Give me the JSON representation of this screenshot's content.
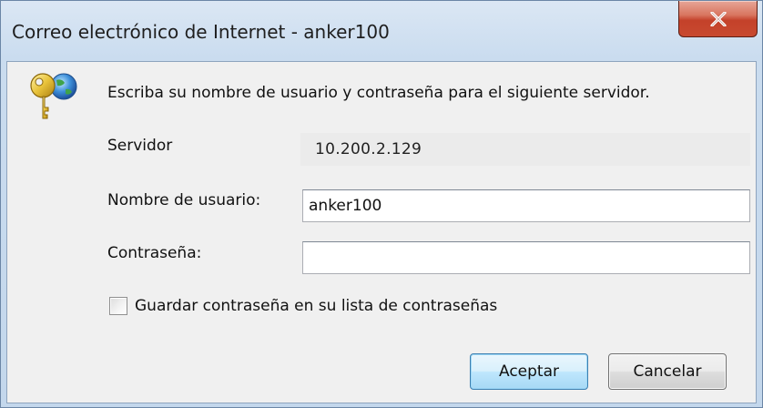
{
  "window": {
    "title": "Correo electrónico de Internet - anker100",
    "close_icon": "close-icon"
  },
  "dialog": {
    "icon": "key-globe-icon",
    "instruction": "Escriba su nombre de usuario y contraseña para el siguiente servidor.",
    "server_label": "Servidor",
    "server_value": "10.200.2.129",
    "username_label": "Nombre de usuario:",
    "username_value": "anker100",
    "password_label": "Contraseña:",
    "password_value": "",
    "save_password_label": "Guardar contraseña en su lista de contraseñas",
    "save_password_checked": false,
    "ok_label": "Aceptar",
    "cancel_label": "Cancelar"
  }
}
